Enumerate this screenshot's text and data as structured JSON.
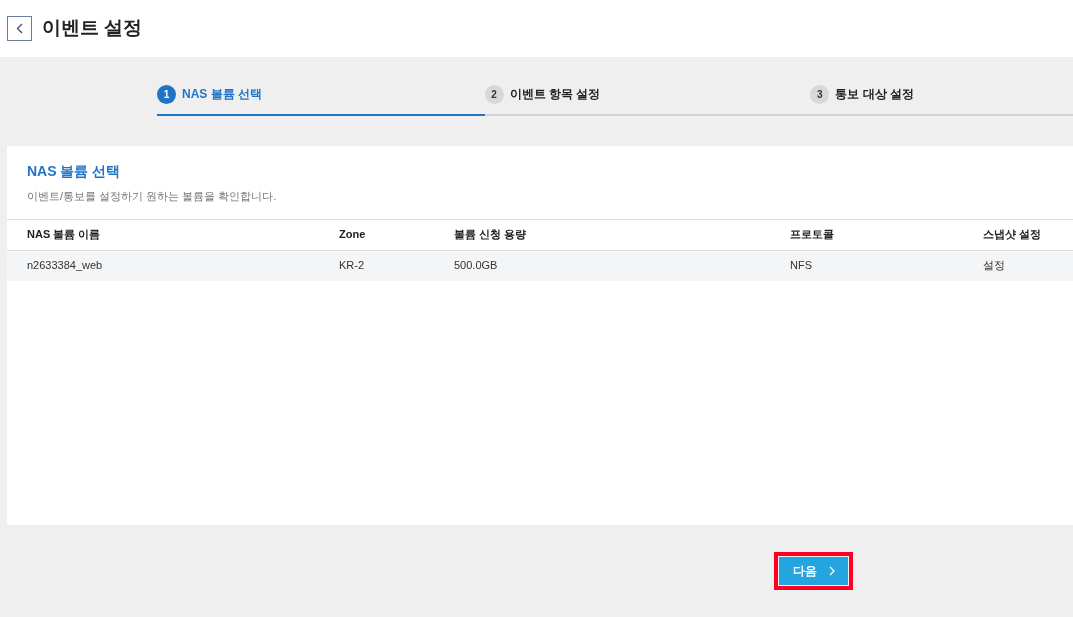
{
  "header": {
    "title": "이벤트 설정"
  },
  "steps": [
    {
      "number": "1",
      "label": "NAS 볼륨 선택",
      "selected": true
    },
    {
      "number": "2",
      "label": "이벤트 항목 설정",
      "selected": false
    },
    {
      "number": "3",
      "label": "통보 대상 설정",
      "selected": false
    }
  ],
  "panel": {
    "title": "NAS 볼륨 선택",
    "description": "이벤트/통보를 설정하기 원하는 볼륨을 확인합니다."
  },
  "table": {
    "columns": [
      "NAS 볼륨 이름",
      "Zone",
      "볼륨 신청 용량",
      "프로토콜",
      "스냅샷 설정"
    ],
    "rows": [
      [
        "n2633384_web",
        "KR-2",
        "500.0GB",
        "NFS",
        "설정"
      ]
    ]
  },
  "next_button": {
    "label": "다음",
    "highlighted": true
  }
}
